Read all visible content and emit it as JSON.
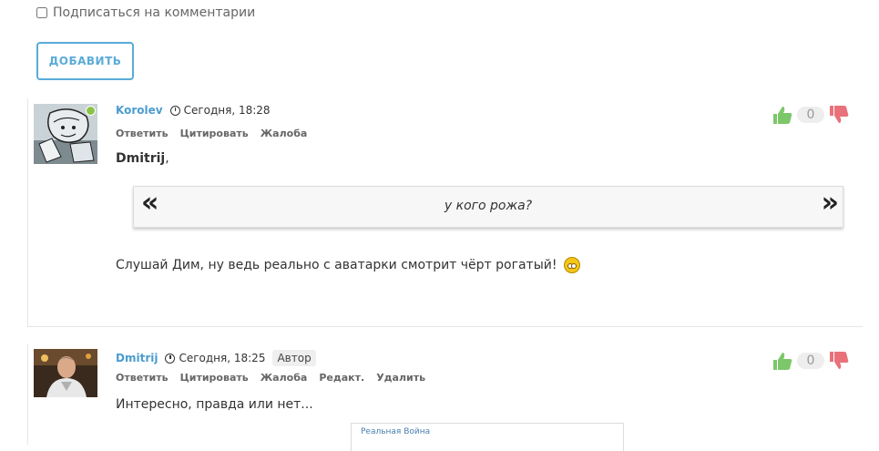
{
  "subscribe": {
    "label": "Подписаться на комментарии",
    "checked": false
  },
  "add_button": {
    "label": "ДОБАВИТЬ"
  },
  "comments": [
    {
      "author": "Korolev",
      "date": "Сегодня, 18:28",
      "actions": [
        "Ответить",
        "Цитировать",
        "Жалоба"
      ],
      "votes": "0",
      "addressee": "Dmitrij",
      "addressee_suffix": ",",
      "quote": "у кого рожа?",
      "quote_open": "«",
      "quote_close": "»",
      "body": "Слушай Дим, ну ведь реально с аватарки смотрит чёрт рогатый!"
    },
    {
      "author": "Dmitrij",
      "date": "Сегодня, 18:25",
      "badge": "Автор",
      "actions": [
        "Ответить",
        "Цитировать",
        "Жалоба",
        "Редакт.",
        "Удалить"
      ],
      "votes": "0",
      "body": "Интересно, правда или нет...",
      "embed_title": "Реальная Война"
    }
  ],
  "colors": {
    "accent": "#5aabd8",
    "author": "#4a9ccf",
    "like": "#7cc76a",
    "dislike": "#e8717a"
  }
}
